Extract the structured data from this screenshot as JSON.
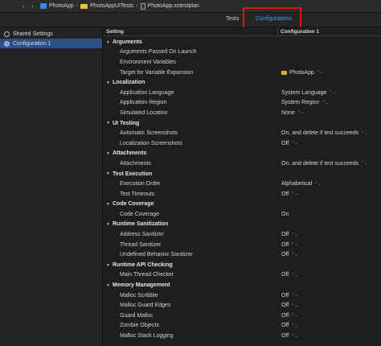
{
  "breadcrumb": [
    {
      "label": "PhotoApp",
      "icon": "app-icon"
    },
    {
      "label": "PhotoAppUITests",
      "icon": "folder-icon"
    },
    {
      "label": "PhotoApp.xctestplan",
      "icon": "file-icon"
    }
  ],
  "nav": {
    "back": "‹",
    "forward": "›"
  },
  "tabs": {
    "tests": "Tests",
    "configurations": "Configurations"
  },
  "colors": {
    "accent": "#4d9cff",
    "highlight": "#e01212",
    "selected": "#2c4f86"
  },
  "sidebar": {
    "items": [
      {
        "label": "Shared Settings",
        "icon": "gear-icon"
      },
      {
        "label": "Configuration 1",
        "icon": "configuration-icon"
      }
    ]
  },
  "table": {
    "header_setting": "Setting",
    "header_config": "Configuration 1",
    "rows": [
      {
        "type": "group",
        "label": "Arguments"
      },
      {
        "type": "setting",
        "label": "Arguments Passed On Launch",
        "value": ""
      },
      {
        "type": "setting",
        "label": "Environment Variables",
        "value": ""
      },
      {
        "type": "setting",
        "label": "Target for Variable Expansion",
        "value": "PhotoApp",
        "icon": true,
        "stepper": true
      },
      {
        "type": "group",
        "label": "Localization"
      },
      {
        "type": "setting",
        "label": "Application Language",
        "value": "System Language",
        "stepper": true
      },
      {
        "type": "setting",
        "label": "Application Region",
        "value": "System Region",
        "stepper": true
      },
      {
        "type": "setting",
        "label": "Simulated Location",
        "value": "None",
        "stepper": true
      },
      {
        "type": "group",
        "label": "UI Testing"
      },
      {
        "type": "setting",
        "label": "Automatic Screenshots",
        "value": "On, and delete if test succeeds",
        "stepper": true
      },
      {
        "type": "setting",
        "label": "Localization Screenshots",
        "value": "Off",
        "stepper": true
      },
      {
        "type": "group",
        "label": "Attachments"
      },
      {
        "type": "setting",
        "label": "Attachments",
        "value": "On, and delete if test succeeds",
        "stepper": true
      },
      {
        "type": "group",
        "label": "Test Execution"
      },
      {
        "type": "setting",
        "label": "Execution Order",
        "value": "Alphabetical",
        "stepper": true
      },
      {
        "type": "setting",
        "label": "Test Timeouts",
        "value": "Off",
        "stepper": true
      },
      {
        "type": "group",
        "label": "Code Coverage"
      },
      {
        "type": "setting",
        "label": "Code Coverage",
        "value": "On",
        "stepper": false
      },
      {
        "type": "group",
        "label": "Runtime Sanitization"
      },
      {
        "type": "setting",
        "label": "Address Sanitizer",
        "value": "Off",
        "stepper": true
      },
      {
        "type": "setting",
        "label": "Thread Sanitizer",
        "value": "Off",
        "stepper": true
      },
      {
        "type": "setting",
        "label": "Undefined Behavior Sanitizer",
        "value": "Off",
        "stepper": true
      },
      {
        "type": "group",
        "label": "Runtime API Checking"
      },
      {
        "type": "setting",
        "label": "Main Thread Checker",
        "value": "Off",
        "stepper": true
      },
      {
        "type": "group",
        "label": "Memory Management"
      },
      {
        "type": "setting",
        "label": "Malloc Scribble",
        "value": "Off",
        "stepper": true
      },
      {
        "type": "setting",
        "label": "Malloc Guard Edges",
        "value": "Off",
        "stepper": true
      },
      {
        "type": "setting",
        "label": "Guard Malloc",
        "value": "Off",
        "stepper": true
      },
      {
        "type": "setting",
        "label": "Zombie Objects",
        "value": "Off",
        "stepper": true
      },
      {
        "type": "setting",
        "label": "Malloc Stack Logging",
        "value": "Off",
        "stepper": true
      }
    ]
  }
}
